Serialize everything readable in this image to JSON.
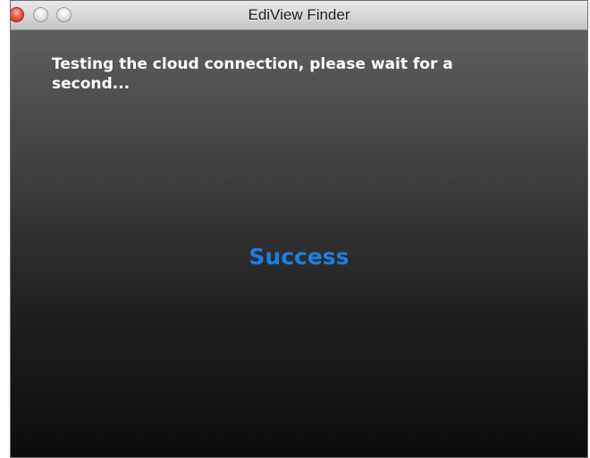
{
  "window": {
    "title": "EdiView Finder"
  },
  "controls": {
    "close": "close-icon",
    "minimize": "minimize-icon",
    "zoom": "zoom-icon"
  },
  "content": {
    "message": "Testing the cloud connection, please wait for a second...",
    "status": "Success"
  },
  "colors": {
    "status_text": "#1b7fe3",
    "message_text": "#ffffff",
    "close_button": "#f0564a"
  }
}
